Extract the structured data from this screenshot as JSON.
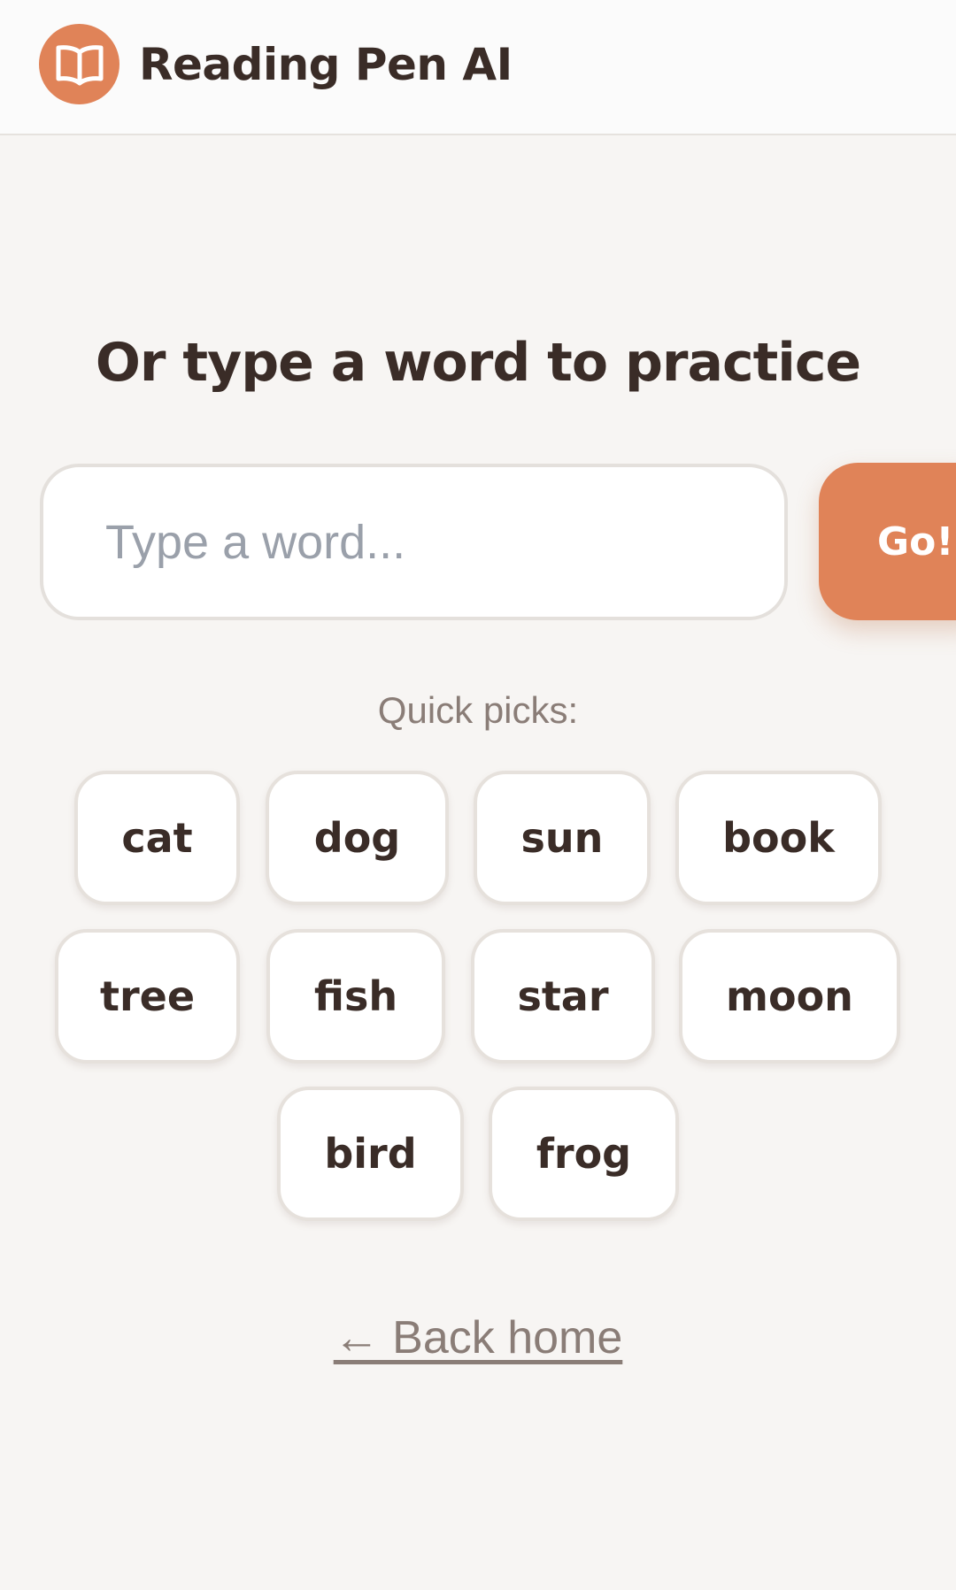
{
  "header": {
    "app_title": "Reading Pen AI",
    "logo_icon": "open-book-icon"
  },
  "practice": {
    "heading": "Or type a word to practice",
    "input_placeholder": "Type a word...",
    "input_value": "",
    "go_label": "Go!"
  },
  "quick_picks": {
    "label": "Quick picks:",
    "words": [
      "cat",
      "dog",
      "sun",
      "book",
      "tree",
      "fish",
      "star",
      "moon",
      "bird",
      "frog"
    ]
  },
  "back_link": "← Back home",
  "colors": {
    "accent": "#e08358",
    "text": "#3a2c27",
    "muted": "#8a7d77",
    "background": "#f7f5f3"
  }
}
